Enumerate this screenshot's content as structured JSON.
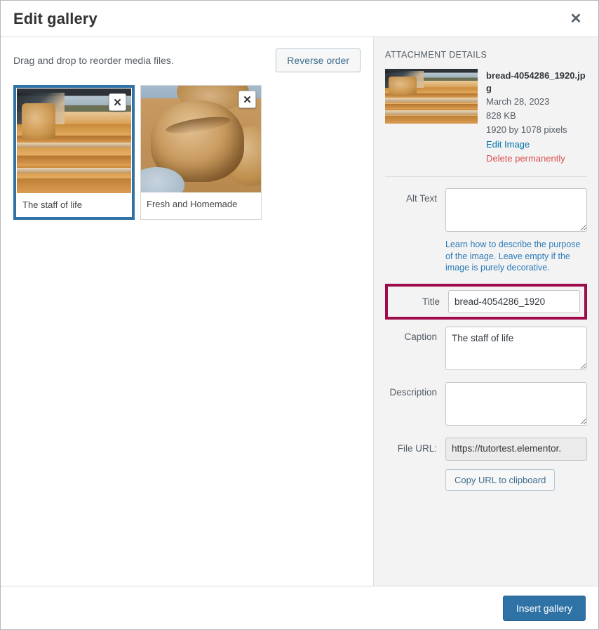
{
  "header": {
    "title": "Edit gallery",
    "close_label": "✕"
  },
  "toolbar": {
    "hint": "Drag and drop to reorder media files.",
    "reverse_label": "Reverse order"
  },
  "gallery": {
    "items": [
      {
        "caption": "The staff of life",
        "remove_label": "✕",
        "selected": true
      },
      {
        "caption": "Fresh and Homemade",
        "remove_label": "✕",
        "selected": false
      }
    ]
  },
  "attachment_details": {
    "heading": "ATTACHMENT DETAILS",
    "filename": "bread-4054286_1920.jpg",
    "date": "March 28, 2023",
    "filesize": "828 KB",
    "dimensions": "1920 by 1078 pixels",
    "edit_image_label": "Edit Image",
    "delete_label": "Delete permanently",
    "fields": {
      "alt_text_label": "Alt Text",
      "alt_text_value": "",
      "alt_text_helper": "Learn how to describe the purpose of the image. Leave empty if the image is purely decorative.",
      "title_label": "Title",
      "title_value": "bread-4054286_1920",
      "caption_label": "Caption",
      "caption_value": "The staff of life",
      "description_label": "Description",
      "description_value": "",
      "file_url_label": "File URL:",
      "file_url_value": "https://tutortest.elementor.",
      "copy_url_label": "Copy URL to clipboard"
    }
  },
  "footer": {
    "insert_label": "Insert gallery"
  },
  "colors": {
    "accent_blue": "#2e72a6",
    "highlight_magenta": "#9e0b4a",
    "link_blue": "#0073aa",
    "delete_red": "#d94f4f",
    "panel_bg": "#f3f3f3"
  }
}
